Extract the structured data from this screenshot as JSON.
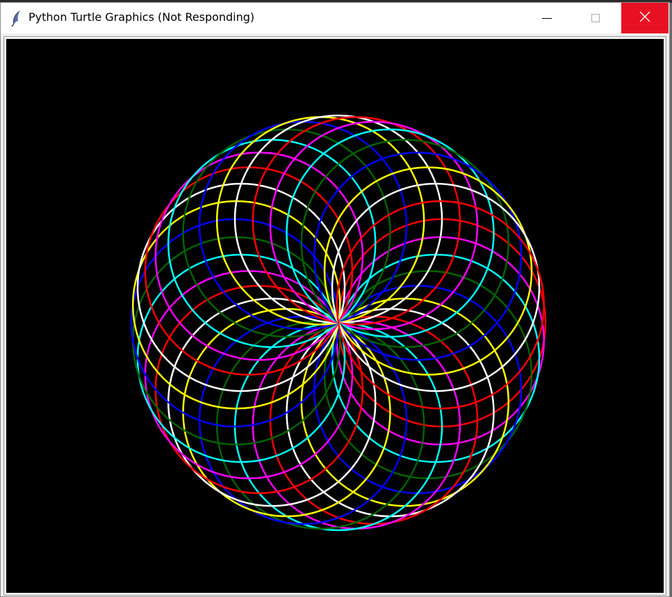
{
  "window": {
    "title": "Python Turtle Graphics (Not Responding)",
    "icon": "feather-icon",
    "controls": {
      "minimize": "minimize-icon",
      "maximize": "maximize-icon",
      "close": "close-icon"
    },
    "close_color": "#e81123"
  },
  "canvas": {
    "background": "#000000",
    "drawing": {
      "pattern": "spirograph",
      "circle_count": 36,
      "colors": [
        "#ff0000",
        "#ff00ff",
        "#00ffff",
        "#006400",
        "#0000ff",
        "#ffff00",
        "#ffffff"
      ]
    }
  }
}
